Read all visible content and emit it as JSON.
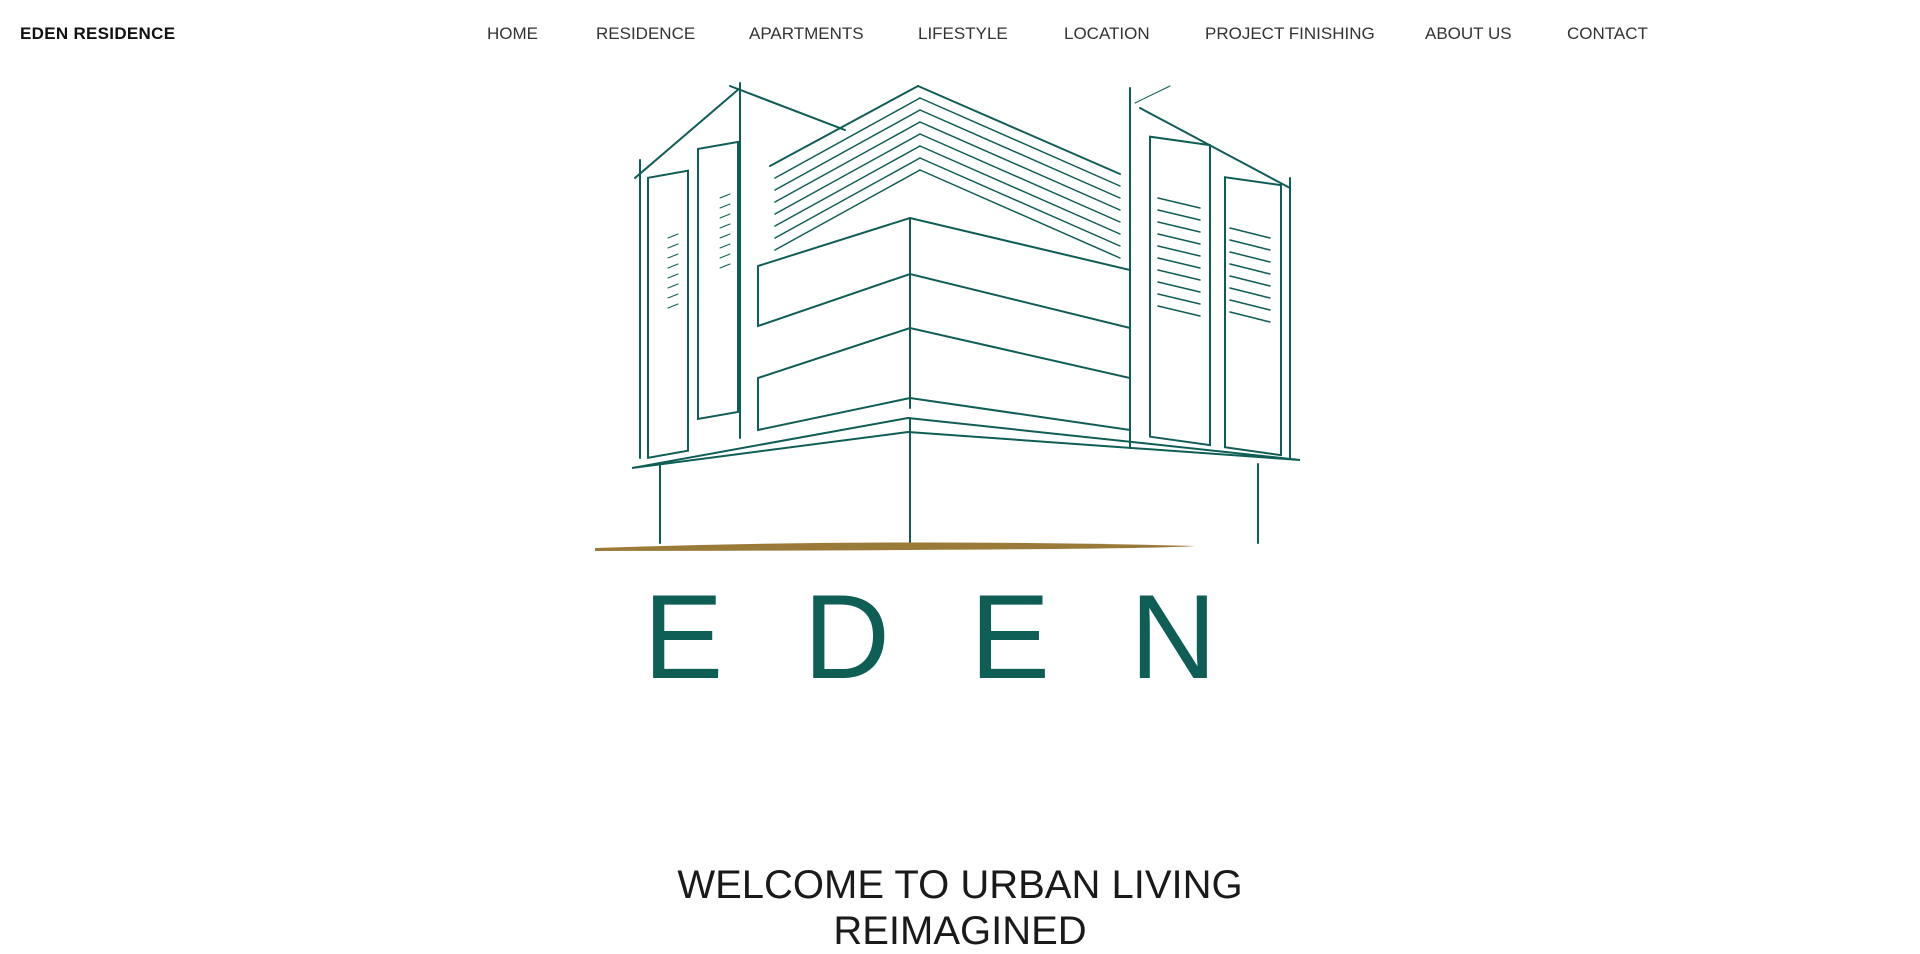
{
  "header": {
    "brand": "EDEN RESIDENCE",
    "nav": [
      {
        "label": "HOME"
      },
      {
        "label": "RESIDENCE"
      },
      {
        "label": "APARTMENTS"
      },
      {
        "label": "LIFESTYLE"
      },
      {
        "label": "LOCATION"
      },
      {
        "label": "PROJECT FINISHING"
      },
      {
        "label": "ABOUT US"
      },
      {
        "label": "CONTACT"
      }
    ]
  },
  "hero": {
    "logo_text": "EDEN",
    "logo_icon": "building-sketch-icon",
    "colors": {
      "primary": "#0f5e55",
      "gold": "#9a7a38"
    }
  },
  "welcome": {
    "line1": "WELCOME TO URBAN LIVING",
    "line2": "REIMAGINED"
  }
}
